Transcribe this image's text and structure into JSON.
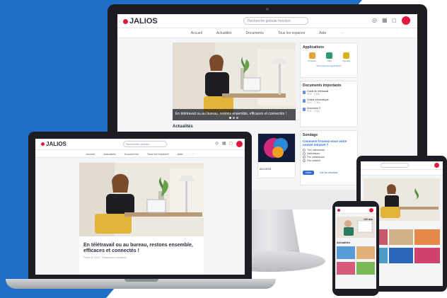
{
  "brand": {
    "name": "JALIOS",
    "accent": "#e2173b",
    "blue": "#1f6fc6"
  },
  "desktop": {
    "search_placeholder": "Recherche globale fonction",
    "nav": [
      "Accueil",
      "Actualités",
      "Documents",
      "Tous les espaces",
      "Aide",
      "⋯"
    ],
    "hero_caption": "En télétravail ou au bureau, restons ensemble, efficaces et connectés !",
    "section_title": "Actualités",
    "news_label": "ACCESS",
    "applications": {
      "title": "Applications",
      "tiles": [
        "Annuaire",
        "Wiki",
        "Agenda"
      ],
      "footer": "Voir toutes les applications"
    },
    "documents": {
      "title": "Documents importants",
      "items": [
        {
          "name": "Guide du télétravail",
          "meta": "PDF · 4 Mo"
        },
        {
          "name": "Charte informatique",
          "meta": "DOC · 1 Mo"
        },
        {
          "name": "Document 3",
          "meta": "PDF · 2 Mo"
        }
      ]
    },
    "poll": {
      "title": "Sondage",
      "question": "Comment trouvez-vous votre nouvel intranet ?",
      "options": [
        "Très satisfaisant",
        "Satisfaisant",
        "Peu satisfaisant",
        "Pas satisfait"
      ],
      "vote_button": "Voter",
      "results_link": "Voir les résultats"
    }
  },
  "laptop": {
    "search_placeholder": "Recherche globale",
    "nav": [
      "Accueil",
      "Actualités",
      "Documents",
      "Tous les espaces",
      "Aide",
      "⋯"
    ],
    "article_title": "En télétravail ou au bureau, restons ensemble, efficaces et connectés !",
    "article_meta": "Publié le 12/03 · Ressources humaines"
  },
  "tablet": {
    "section_title": "Actualités"
  },
  "phone": {
    "section_title": "Actualités",
    "badge": "100 ans"
  }
}
